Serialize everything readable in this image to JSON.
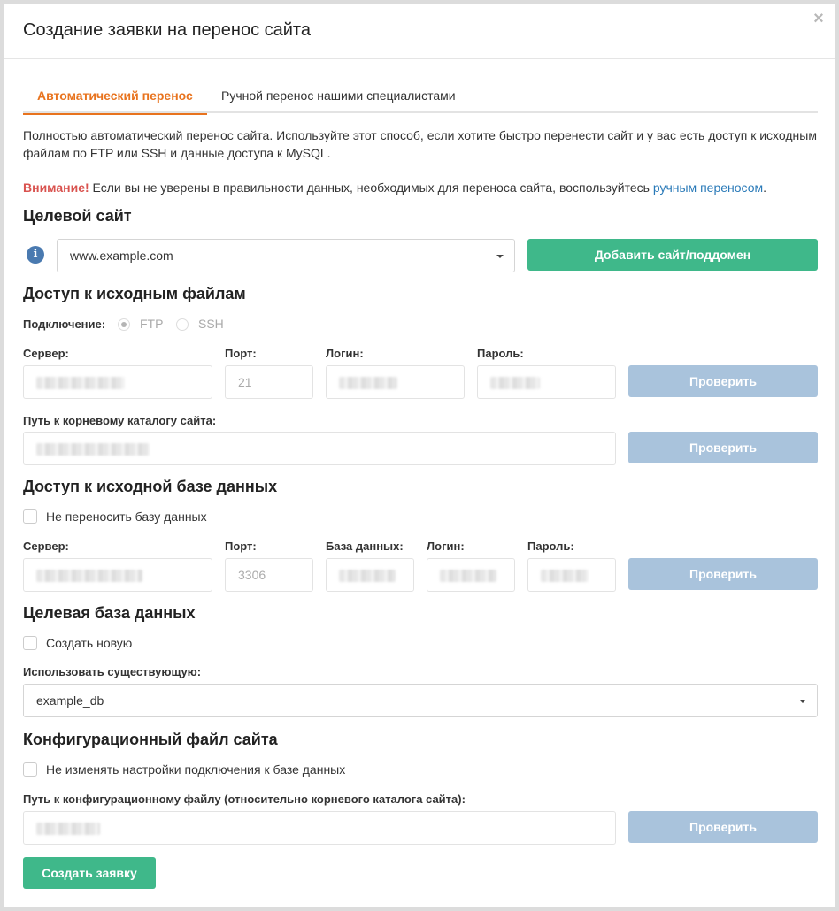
{
  "modal": {
    "title": "Создание заявки на перенос сайта",
    "close_symbol": "×"
  },
  "tabs": [
    {
      "label": "Автоматический перенос",
      "active": true
    },
    {
      "label": "Ручной перенос нашими специалистами",
      "active": false
    }
  ],
  "description": "Полностью автоматический перенос сайта. Используйте этот способ, если хотите быстро перенести сайт и у вас есть доступ к исходным файлам по FTP или SSH и данные доступа к MySQL.",
  "warning": {
    "prefix": "Внимание!",
    "text": " Если вы не уверены в правильности данных, необходимых для переноса сайта, воспользуйтесь ",
    "link": "ручным переносом",
    "suffix": "."
  },
  "target_site": {
    "heading": "Целевой сайт",
    "info_icon": "i",
    "selected": "www.example.com",
    "add_button": "Добавить сайт/поддомен"
  },
  "files_access": {
    "heading": "Доступ к исходным файлам",
    "connection_label": "Подключение:",
    "options": [
      "FTP",
      "SSH"
    ],
    "selected_option": "FTP",
    "server_label": "Сервер:",
    "port_label": "Порт:",
    "port_value": "21",
    "login_label": "Логин:",
    "password_label": "Пароль:",
    "check_button": "Проверить",
    "root_path_label": "Путь к корневому каталогу сайта:",
    "root_check_button": "Проверить"
  },
  "db_access": {
    "heading": "Доступ к исходной базе данных",
    "no_transfer_label": "Не переносить базу данных",
    "server_label": "Сервер:",
    "port_label": "Порт:",
    "port_value": "3306",
    "db_label": "База данных:",
    "login_label": "Логин:",
    "password_label": "Пароль:",
    "check_button": "Проверить"
  },
  "target_db": {
    "heading": "Целевая база данных",
    "create_new_label": "Создать новую",
    "use_existing_label": "Использовать существующую:",
    "selected": "example_db"
  },
  "config_file": {
    "heading": "Конфигурационный файл сайта",
    "no_change_label": "Не изменять настройки подключения к базе данных",
    "path_label": "Путь к конфигурационному файлу (относительно корневого каталога сайта):",
    "check_button": "Проверить"
  },
  "submit_button": "Создать заявку",
  "colors": {
    "accent_orange": "#e8731e",
    "green_button": "#3fb88a",
    "disabled_button": "#a9c3dc",
    "warning_red": "#d9534f",
    "link_blue": "#2a7ab8"
  }
}
